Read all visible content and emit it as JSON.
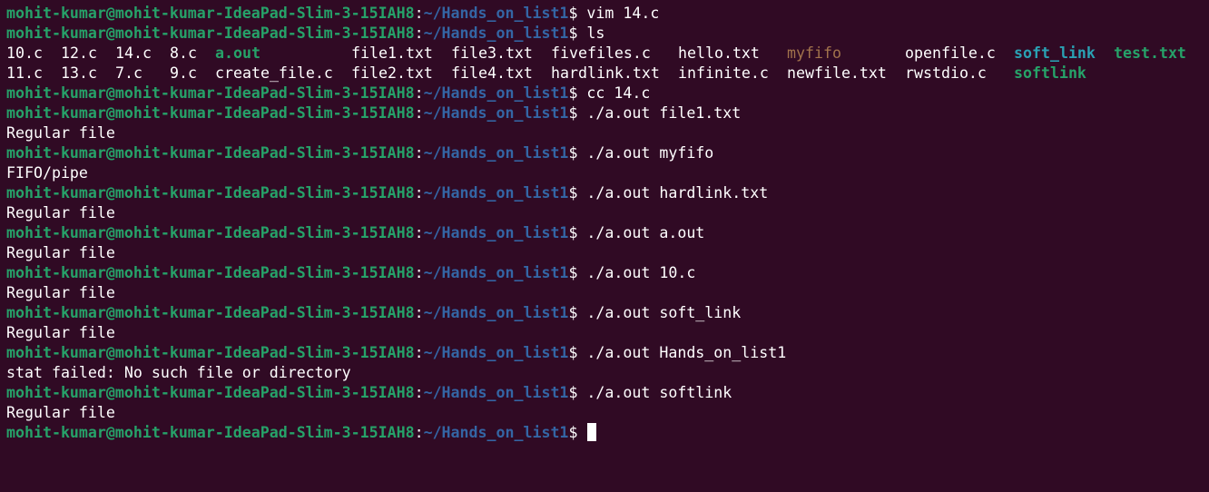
{
  "colors": {
    "background": "#300a24",
    "user_host": "#26a269",
    "path": "#3465a4",
    "text": "#ffffff",
    "exec": "#26a269",
    "fifo": "#a2734c",
    "symlink": "#2aa1b3"
  },
  "prompt": {
    "user_host": "mohit-kumar@mohit-kumar-IdeaPad-Slim-3-15IAH8",
    "colon": ":",
    "path": "~/Hands_on_list1",
    "dollar": "$ "
  },
  "lines": [
    {
      "kind": "prompt",
      "command": "vim 14.c"
    },
    {
      "kind": "prompt",
      "command": "ls"
    },
    {
      "kind": "ls"
    },
    {
      "kind": "prompt",
      "command": "cc 14.c"
    },
    {
      "kind": "prompt",
      "command": "./a.out file1.txt"
    },
    {
      "kind": "output",
      "text": "Regular file"
    },
    {
      "kind": "prompt",
      "command": "./a.out myfifo"
    },
    {
      "kind": "output",
      "text": "FIFO/pipe"
    },
    {
      "kind": "prompt",
      "command": "./a.out hardlink.txt"
    },
    {
      "kind": "output",
      "text": "Regular file"
    },
    {
      "kind": "prompt",
      "command": "./a.out a.out"
    },
    {
      "kind": "output",
      "text": "Regular file"
    },
    {
      "kind": "prompt",
      "command": "./a.out 10.c"
    },
    {
      "kind": "output",
      "text": "Regular file"
    },
    {
      "kind": "prompt",
      "command": "./a.out soft_link"
    },
    {
      "kind": "output",
      "text": "Regular file"
    },
    {
      "kind": "prompt",
      "command": "./a.out Hands_on_list1"
    },
    {
      "kind": "output",
      "text": "stat failed: No such file or directory"
    },
    {
      "kind": "prompt",
      "command": "./a.out softlink"
    },
    {
      "kind": "output",
      "text": "Regular file"
    },
    {
      "kind": "prompt",
      "command": "",
      "cursor": true
    }
  ],
  "ls_listing": {
    "rows": [
      [
        {
          "name": "10.c",
          "type": "plain"
        },
        {
          "name": "12.c",
          "type": "plain"
        },
        {
          "name": "14.c",
          "type": "plain"
        },
        {
          "name": "8.c",
          "type": "plain"
        },
        {
          "name": "a.out",
          "type": "exec"
        },
        {
          "name": "file1.txt",
          "type": "plain"
        },
        {
          "name": "file3.txt",
          "type": "plain"
        },
        {
          "name": "fivefiles.c",
          "type": "plain"
        },
        {
          "name": "hello.txt",
          "type": "plain"
        },
        {
          "name": "myfifo",
          "type": "fifo"
        },
        {
          "name": "openfile.c",
          "type": "plain"
        },
        {
          "name": "soft_link",
          "type": "symlink"
        },
        {
          "name": "test.txt",
          "type": "exec"
        }
      ],
      [
        {
          "name": "11.c",
          "type": "plain"
        },
        {
          "name": "13.c",
          "type": "plain"
        },
        {
          "name": "7.c",
          "type": "plain"
        },
        {
          "name": "9.c",
          "type": "plain"
        },
        {
          "name": "create_file.c",
          "type": "plain"
        },
        {
          "name": "file2.txt",
          "type": "plain"
        },
        {
          "name": "file4.txt",
          "type": "plain"
        },
        {
          "name": "hardlink.txt",
          "type": "plain"
        },
        {
          "name": "infinite.c",
          "type": "plain"
        },
        {
          "name": "newfile.txt",
          "type": "plain"
        },
        {
          "name": "rwstdio.c",
          "type": "plain"
        },
        {
          "name": "softlink",
          "type": "exec"
        }
      ]
    ]
  }
}
